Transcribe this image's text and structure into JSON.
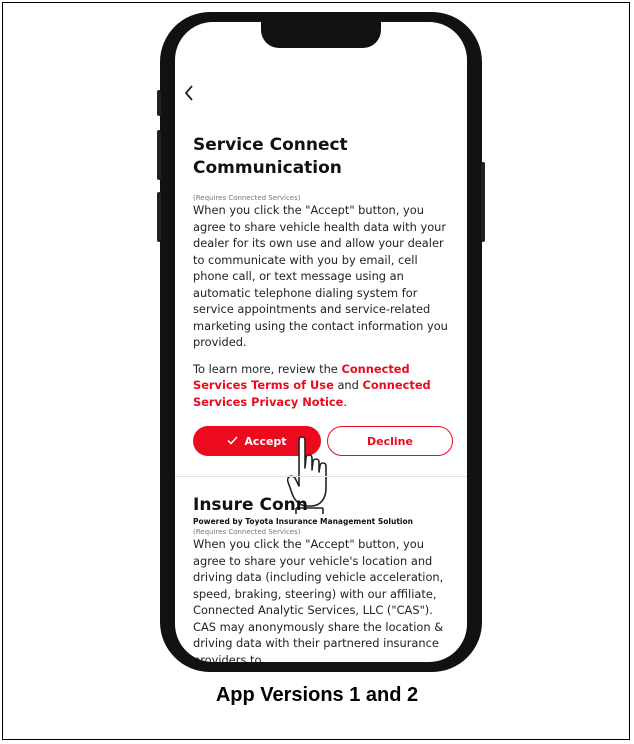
{
  "screen": {
    "back_icon": "chevron-left-icon",
    "title": "Service Connect Communication",
    "requires_note": "(Requires Connected Services)",
    "consent_text": "When you click the \"Accept\" button, you agree to share vehicle health data with your dealer for its own use and allow your dealer to communicate with you by email, cell phone call, or text message using an automatic telephone dialing system for service appointments and service-related marketing using the contact information you provided.",
    "learn_more_prefix": "To learn more, review the ",
    "terms_link": "Connected Services Terms of Use",
    "learn_more_and": " and ",
    "privacy_link": "Connected Services Privacy Notice",
    "learn_more_suffix": ".",
    "accept_label": "Accept",
    "decline_label": "Decline",
    "accent_color": "#eb0a1e"
  },
  "section2": {
    "title": "Insure Conn",
    "subtitle": "Powered by Toyota Insurance Management Solution",
    "requires_note": "(Requires Connected Services)",
    "consent_text": "When you click the \"Accept\" button, you agree to share your vehicle's location and driving data (including vehicle acceleration, speed, braking, steering) with our affiliate, Connected Analytic Services, LLC (\"CAS\"). CAS may anonymously share the location & driving data with their partnered insurance providers to"
  },
  "caption": "App Versions 1 and 2"
}
